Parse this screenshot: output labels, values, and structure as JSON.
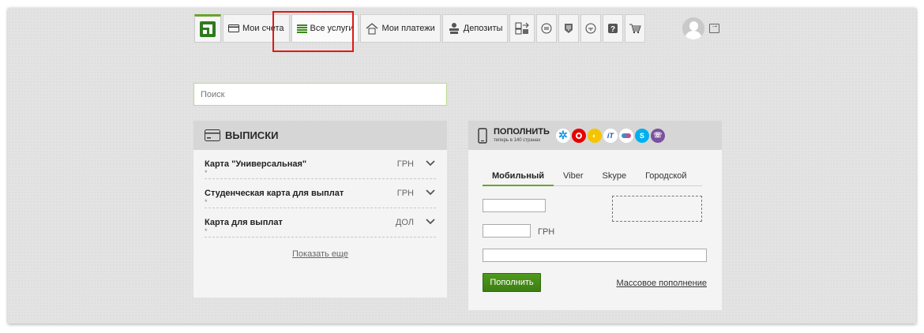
{
  "nav": {
    "tabs": [
      {
        "label": "Мои счета",
        "icon": "card-icon"
      },
      {
        "label": "Все услуги",
        "icon": "list-icon"
      },
      {
        "label": "Мои платежи",
        "icon": "home-icon"
      },
      {
        "label": "Депозиты",
        "icon": "coins-icon"
      }
    ],
    "icon_tabs": [
      "transfer-icon",
      "exchange-icon",
      "emblem-icon",
      "clock-icon",
      "help-icon",
      "cart-icon"
    ],
    "accent": "#6aa32b"
  },
  "search": {
    "placeholder": "Поиск"
  },
  "statements": {
    "title": "ВЫПИСКИ",
    "accounts": [
      {
        "name": "Карта \"Универсальная\"",
        "mask": "*",
        "currency": "ГРН"
      },
      {
        "name": "Студенческая карта для выплат",
        "mask": "*",
        "currency": "ГРН"
      },
      {
        "name": "Карта для выплат",
        "mask": "*",
        "currency": "ДОЛ"
      }
    ],
    "show_more": "Показать еще"
  },
  "topup": {
    "title": "ПОПОЛНИТЬ",
    "subtitle": "теперь в 140 странах",
    "operators": [
      {
        "name": "kyivstar",
        "color": "#1e9be3"
      },
      {
        "name": "vodafone",
        "color": "#e60000"
      },
      {
        "name": "lifecell",
        "color": "#f5c400"
      },
      {
        "name": "intertelecom",
        "color": "#1b5aa8"
      },
      {
        "name": "trimob",
        "color": "#1aa0d6"
      },
      {
        "name": "skype",
        "color": "#00aff0"
      },
      {
        "name": "viber",
        "color": "#7b519d"
      }
    ],
    "tabs": [
      "Мобильный",
      "Viber",
      "Skype",
      "Городской"
    ],
    "currency": "ГРН",
    "button": "Пополнить",
    "mass_link": "Массовое пополнение"
  }
}
